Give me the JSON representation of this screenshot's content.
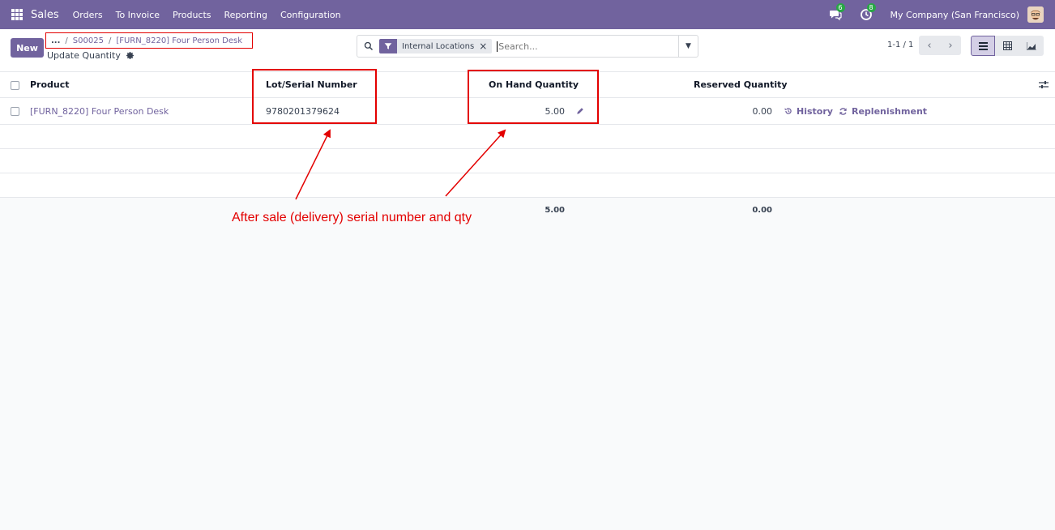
{
  "navbar": {
    "app_name": "Sales",
    "menu": [
      "Orders",
      "To Invoice",
      "Products",
      "Reporting",
      "Configuration"
    ],
    "messages_count": "6",
    "activities_count": "8",
    "company": "My Company (San Francisco)",
    "color": "#71639e"
  },
  "control": {
    "new_label": "New",
    "breadcrumb": {
      "more": "...",
      "order": "S00025",
      "product": "[FURN_8220] Four Person Desk"
    },
    "subtitle": "Update Quantity",
    "search": {
      "facet": "Internal Locations",
      "placeholder": "Search..."
    },
    "pager": "1-1 / 1"
  },
  "table": {
    "columns": {
      "product": "Product",
      "lot": "Lot/Serial Number",
      "on_hand": "On Hand Quantity",
      "reserved": "Reserved Quantity"
    },
    "rows": [
      {
        "product": "[FURN_8220] Four Person Desk",
        "lot": "9780201379624",
        "on_hand": "5.00",
        "reserved": "0.00",
        "history": "History",
        "replenishment": "Replenishment"
      }
    ],
    "totals": {
      "on_hand": "5.00",
      "reserved": "0.00"
    }
  },
  "annotation": {
    "text": "After sale (delivery) serial number and qty",
    "color": "#e30000"
  }
}
